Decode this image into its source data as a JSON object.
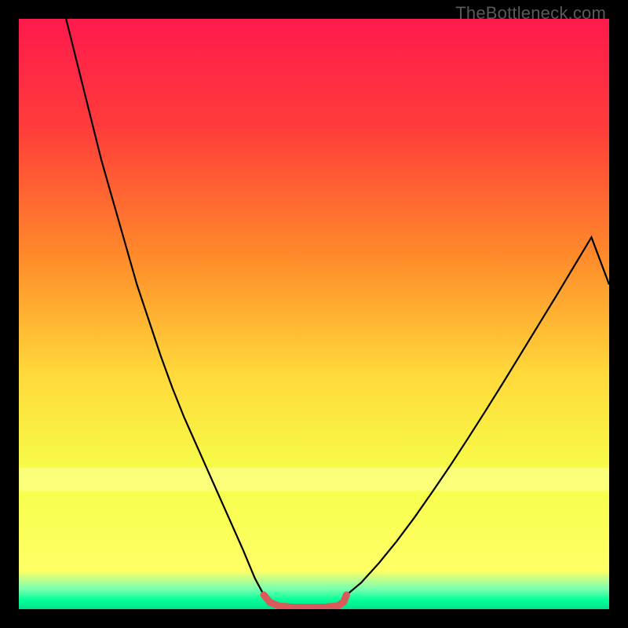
{
  "watermark": "TheBottleneck.com",
  "chart_data": {
    "type": "line",
    "title": "",
    "xlabel": "",
    "ylabel": "",
    "xlim": [
      0,
      100
    ],
    "ylim": [
      0,
      100
    ],
    "grid": false,
    "legend": false,
    "background_gradient": {
      "stops": [
        {
          "offset": 0.0,
          "color": "#ff1a4d"
        },
        {
          "offset": 0.18,
          "color": "#ff3b3b"
        },
        {
          "offset": 0.4,
          "color": "#ff8a2a"
        },
        {
          "offset": 0.6,
          "color": "#ffd83a"
        },
        {
          "offset": 0.78,
          "color": "#f6ff4a"
        },
        {
          "offset": 0.935,
          "color": "#ffff66"
        },
        {
          "offset": 0.965,
          "color": "#7dffb0"
        },
        {
          "offset": 0.985,
          "color": "#00ff99"
        },
        {
          "offset": 1.0,
          "color": "#00e088"
        }
      ]
    },
    "pale_band": {
      "y0": 76,
      "y1": 80,
      "color": "#ffffa0",
      "opacity": 0.55
    },
    "series": [
      {
        "name": "left-curve",
        "stroke": "#000000",
        "stroke_width": 2.2,
        "x": [
          8,
          10,
          12,
          14,
          16,
          18,
          20,
          22,
          24,
          26,
          28,
          30,
          32,
          34,
          36,
          38,
          40,
          41.5
        ],
        "y": [
          100,
          92,
          84,
          76,
          69,
          62,
          55,
          49,
          43,
          37.5,
          32.5,
          28,
          23.5,
          19,
          14.5,
          10,
          5.2,
          2.4
        ]
      },
      {
        "name": "right-curve",
        "stroke": "#000000",
        "stroke_width": 2.2,
        "x": [
          55.5,
          58,
          61,
          64,
          67,
          70,
          73,
          76,
          79,
          82,
          85,
          88,
          91,
          94,
          97,
          100
        ],
        "y": [
          2.4,
          4.5,
          7.8,
          11.5,
          15.5,
          19.8,
          24.2,
          28.8,
          33.5,
          38.3,
          43.2,
          48.1,
          53,
          58,
          63,
          55
        ]
      },
      {
        "name": "valley-marker",
        "stroke": "#d85a5a",
        "stroke_width": 9,
        "linecap": "round",
        "x": [
          41.5,
          42.5,
          44,
          46,
          49,
          52,
          54,
          55,
          55.5
        ],
        "y": [
          2.4,
          1.2,
          0.55,
          0.35,
          0.3,
          0.35,
          0.55,
          1.2,
          2.4
        ]
      }
    ]
  }
}
